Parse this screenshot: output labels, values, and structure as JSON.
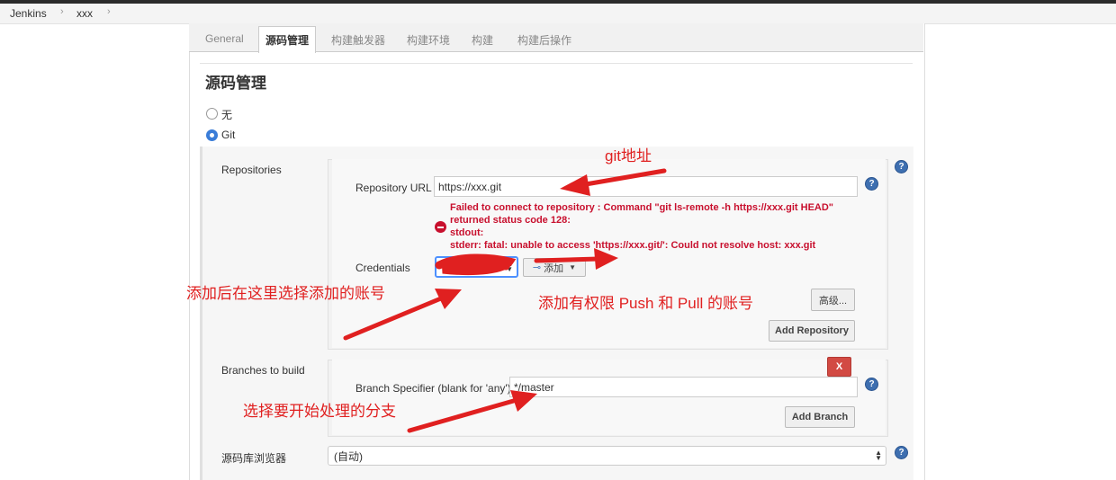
{
  "breadcrumb": {
    "items": [
      "Jenkins",
      "xxx"
    ],
    "separator": "›"
  },
  "tabs": [
    "General",
    "源码管理",
    "构建触发器",
    "构建环境",
    "构建",
    "构建后操作"
  ],
  "active_tab": "源码管理",
  "section_title": "源码管理",
  "scm_options": [
    {
      "label": "无",
      "checked": false
    },
    {
      "label": "Git",
      "checked": true
    }
  ],
  "repositories": {
    "label": "Repositories",
    "repo_url_label": "Repository URL",
    "repo_url_value": "https://xxx.git",
    "error_lines": [
      "Failed to connect to repository : Command \"git ls-remote -h https://xxx.git HEAD\"",
      "returned status code 128:",
      "stdout:",
      "stderr: fatal: unable to access 'https://xxx.git/': Could not resolve host: xxx.git"
    ],
    "credentials_label": "Credentials",
    "add_button_label": "添加",
    "advanced_button_label": "高级...",
    "add_repository_label": "Add Repository"
  },
  "branches": {
    "label": "Branches to build",
    "delete_label": "X",
    "specifier_label": "Branch Specifier (blank for 'any')",
    "specifier_value": "*/master",
    "add_branch_label": "Add Branch"
  },
  "browser": {
    "label": "源码库浏览器",
    "selected": "(自动)"
  },
  "annotations": {
    "git_address": "git地址",
    "select_added_account": "添加后在这里选择添加的账号",
    "add_push_pull_account": "添加有权限 Push 和 Pull 的账号",
    "select_branch": "选择要开始处理的分支"
  },
  "colors": {
    "annotation": "#e02020",
    "error": "#c8102e",
    "focus_border": "#4d90fe",
    "help_icon": "#3e6fb0"
  }
}
